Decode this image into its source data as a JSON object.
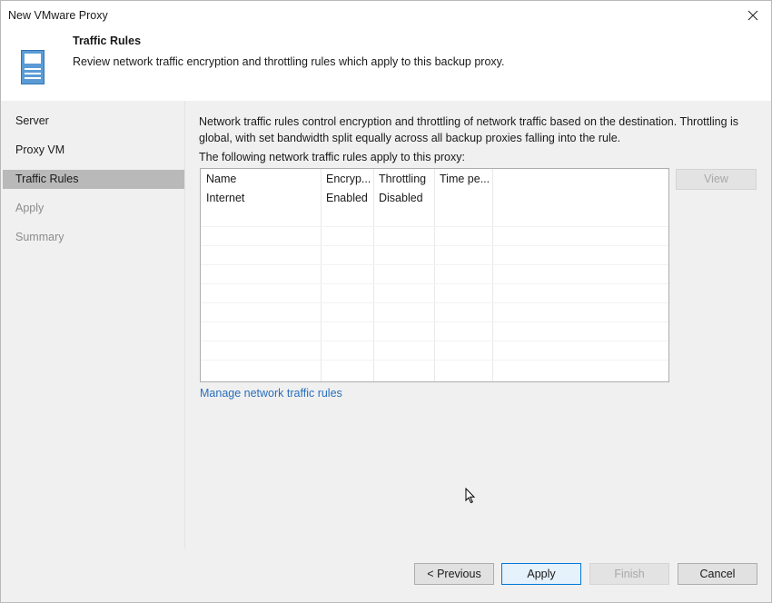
{
  "window": {
    "title": "New VMware Proxy"
  },
  "header": {
    "title": "Traffic Rules",
    "subtitle": "Review network traffic encryption and throttling rules which apply to this backup proxy.",
    "icon": "server-icon"
  },
  "nav": {
    "items": [
      {
        "label": "Server",
        "state": "normal"
      },
      {
        "label": "Proxy VM",
        "state": "normal"
      },
      {
        "label": "Traffic Rules",
        "state": "active"
      },
      {
        "label": "Apply",
        "state": "disabled"
      },
      {
        "label": "Summary",
        "state": "disabled"
      }
    ]
  },
  "content": {
    "description": "Network traffic rules control encryption and throttling of network traffic based on the destination. Throttling is global, with set bandwidth split equally across all backup proxies falling into the rule.",
    "list_label": "The following network traffic rules apply to this proxy:",
    "table": {
      "columns": [
        "Name",
        "Encryp...",
        "Throttling",
        "Time pe..."
      ],
      "rows": [
        [
          "Internet",
          "Enabled",
          "Disabled",
          ""
        ]
      ]
    },
    "view_button": "View",
    "manage_link": "Manage network traffic rules"
  },
  "footer": {
    "previous": "< Previous",
    "apply": "Apply",
    "finish": "Finish",
    "cancel": "Cancel"
  },
  "colors": {
    "accent": "#0078d7",
    "link": "#2a6ebb",
    "panel": "#f0f0f0",
    "nav_active": "#b9b9b9",
    "icon_blue": "#5b9bd5"
  }
}
